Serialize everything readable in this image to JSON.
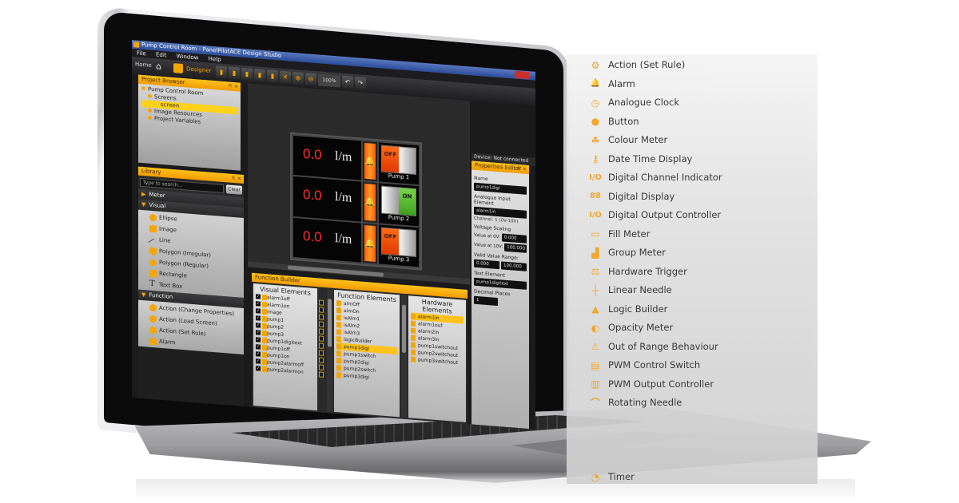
{
  "app": {
    "window_title": "Pump Control Room - PanelPilotACE Design Studio",
    "menu": [
      "File",
      "Edit",
      "Window",
      "Help"
    ],
    "ribbon": {
      "home_label": "Home",
      "designer_label": "Designer",
      "zoom_level": "100%"
    }
  },
  "project_browser": {
    "title": "Project Browser",
    "tree": [
      {
        "label": "Pump Control Room",
        "level": 0
      },
      {
        "label": "Screens",
        "level": 1
      },
      {
        "label": "screen",
        "level": 2,
        "selected": true
      },
      {
        "label": "Image Resources",
        "level": 1
      },
      {
        "label": "Project Variables",
        "level": 1
      }
    ]
  },
  "library": {
    "title": "Library",
    "search_placeholder": "Type to search...",
    "clear_label": "Clear",
    "categories": [
      {
        "label": "Meter",
        "expanded": false,
        "items": []
      },
      {
        "label": "Visual",
        "expanded": true,
        "items": [
          "Ellipse",
          "Image",
          "Line",
          "Polygon (Irregular)",
          "Polygon (Regular)",
          "Rectangle",
          "Text Box"
        ]
      },
      {
        "label": "Function",
        "expanded": true,
        "items": [
          "Action (Change Properties)",
          "Action (Load Screen)",
          "Action (Set Rule)",
          "Alarm"
        ]
      }
    ]
  },
  "canvas": {
    "rows": [
      {
        "value": "0.0",
        "unit": "l/m",
        "switch_state": "OFF",
        "pump_label": "Pump 1"
      },
      {
        "value": "0.0",
        "unit": "l/m",
        "switch_state": "ON",
        "pump_label": "Pump 2"
      },
      {
        "value": "0.0",
        "unit": "l/m",
        "switch_state": "OFF",
        "pump_label": "Pump 3"
      }
    ]
  },
  "device": {
    "label": "Device:",
    "status": "Not connected"
  },
  "properties": {
    "title": "Properties Editor",
    "name_label": "Name",
    "name_value": "pump1digi",
    "analogue_input_label": "Analogue Input Element",
    "analogue_input_value": "alarm1in",
    "channel_note": "Channel: 1 (0V-10V)",
    "voltage_scaling_label": "Voltage Scaling",
    "value_at_0v_label": "Value at 0V:",
    "value_at_0v": "0.000",
    "value_at_10v_label": "Value at 10V:",
    "value_at_10v": "100.000",
    "valid_range_label": "Valid Value Range:",
    "valid_min": "0.000",
    "valid_max": "100.000",
    "text_element_label": "Text Element",
    "text_element_value": "pump1digitext",
    "decimal_places_label": "Decimal Places",
    "decimal_places_value": "1"
  },
  "function_builder": {
    "title": "Function Builder",
    "visual_elements": {
      "heading": "Visual Elements",
      "items": [
        "alarm1off",
        "alarm1on",
        "image",
        "pump1",
        "pump2",
        "pump3",
        "pump1digitext",
        "pump1off",
        "pump1on",
        "pump2alarmoff",
        "pump2alarmon"
      ]
    },
    "function_elements": {
      "heading": "Function Elements",
      "items": [
        "almOff",
        "almOn",
        "isAlm1",
        "isAlm2",
        "isAlm3",
        "logicBuilder",
        "pump1digi",
        "pump1switch",
        "pump2digi",
        "pump2switch",
        "pump3digi"
      ],
      "selected": "pump1digi"
    },
    "hardware_elements": {
      "heading": "Hardware Elements",
      "items": [
        "alarm1in",
        "alarm1out",
        "alarm2in",
        "alarm3in",
        "pump1switchout",
        "pump2switchout",
        "pump3switchout"
      ],
      "selected": "alarm1in"
    }
  },
  "feature_list": {
    "items": [
      {
        "label": "Action (Set Rule)",
        "icon": "gear-play-icon"
      },
      {
        "label": "Alarm",
        "icon": "bell-icon"
      },
      {
        "label": "Analogue Clock",
        "icon": "clock-icon"
      },
      {
        "label": "Button",
        "icon": "button-icon"
      },
      {
        "label": "Colour Meter",
        "icon": "colour-meter-icon"
      },
      {
        "label": "Date Time Display",
        "icon": "date-time-icon"
      },
      {
        "label": "Digital Channel Indicator",
        "icon": "io-indicator-icon"
      },
      {
        "label": "Digital Display",
        "icon": "seven-segment-icon"
      },
      {
        "label": "Digital Output Controller",
        "icon": "io-controller-icon"
      },
      {
        "label": "Fill Meter",
        "icon": "fill-meter-icon"
      },
      {
        "label": "Group Meter",
        "icon": "bar-meter-icon"
      },
      {
        "label": "Hardware Trigger",
        "icon": "seesaw-icon"
      },
      {
        "label": "Linear Needle",
        "icon": "linear-needle-icon"
      },
      {
        "label": "Logic Builder",
        "icon": "blocks-icon"
      },
      {
        "label": "Opacity Meter",
        "icon": "half-circle-icon"
      },
      {
        "label": "Out of Range Behaviour",
        "icon": "warning-icon"
      },
      {
        "label": "PWM Control Switch",
        "icon": "pwm-switch-icon"
      },
      {
        "label": "PWM Output Controller",
        "icon": "pwm-output-icon"
      },
      {
        "label": "Rotating Needle",
        "icon": "rotating-needle-icon"
      },
      {
        "label": "Timer",
        "icon": "timer-icon"
      }
    ]
  },
  "colors": {
    "accent": "#f5a500",
    "readout_red": "#ff2a2a",
    "switch_on": "#5cbf34",
    "switch_off": "#ff5a10",
    "titlebar": "#3a5cae"
  }
}
